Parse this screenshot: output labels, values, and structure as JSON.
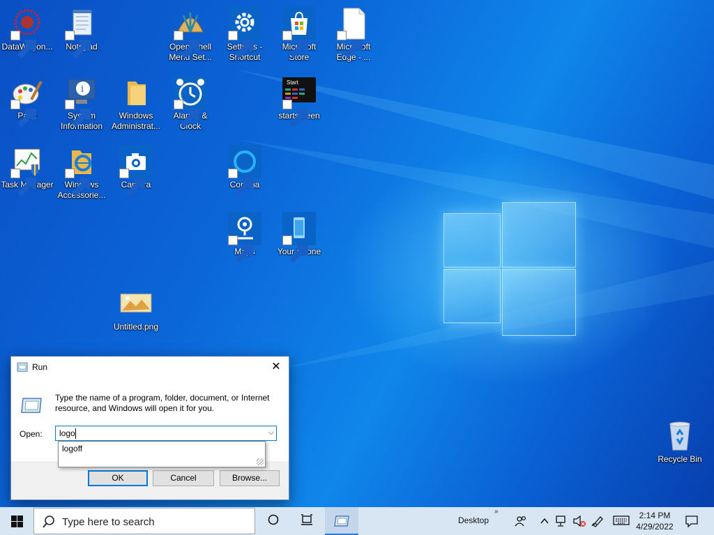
{
  "desktop": {
    "icons": [
      {
        "label": "DataWagon..."
      },
      {
        "label": "Notepad"
      },
      {
        "label": "Open-Shell Menu Set..."
      },
      {
        "label": "Settings - Shortcut"
      },
      {
        "label": "Microsoft Store"
      },
      {
        "label": "Microsoft Edge - ..."
      },
      {
        "label": "Paint"
      },
      {
        "label": "System Information"
      },
      {
        "label": "Windows Administrat..."
      },
      {
        "label": "Alarms & Clock"
      },
      {
        "label": "startscreen"
      },
      {
        "label": "Task Manager"
      },
      {
        "label": "Windows Accessorie..."
      },
      {
        "label": "Camera"
      },
      {
        "label": "Cortana"
      },
      {
        "label": "Maps"
      },
      {
        "label": "Your Phone"
      },
      {
        "label": "Untitled.png"
      },
      {
        "label": "Recycle Bin"
      }
    ],
    "startscreen_thumb_text": "Start"
  },
  "run_dialog": {
    "title": "Run",
    "message": "Type the name of a program, folder, document, or Internet resource, and Windows will open it for you.",
    "open_label": "Open:",
    "open_value": "logo",
    "suggestion": "logoff",
    "ok_label": "OK",
    "cancel_label": "Cancel",
    "browse_label": "Browse..."
  },
  "taskbar": {
    "search_placeholder": "Type here to search",
    "desktop_label": "Desktop",
    "time": "2:14 PM",
    "date": "4/29/2022"
  },
  "colors": {
    "accent": "#0078d7",
    "taskbar": "#d8e6f4",
    "desktop_blue": "#0b66d8"
  }
}
